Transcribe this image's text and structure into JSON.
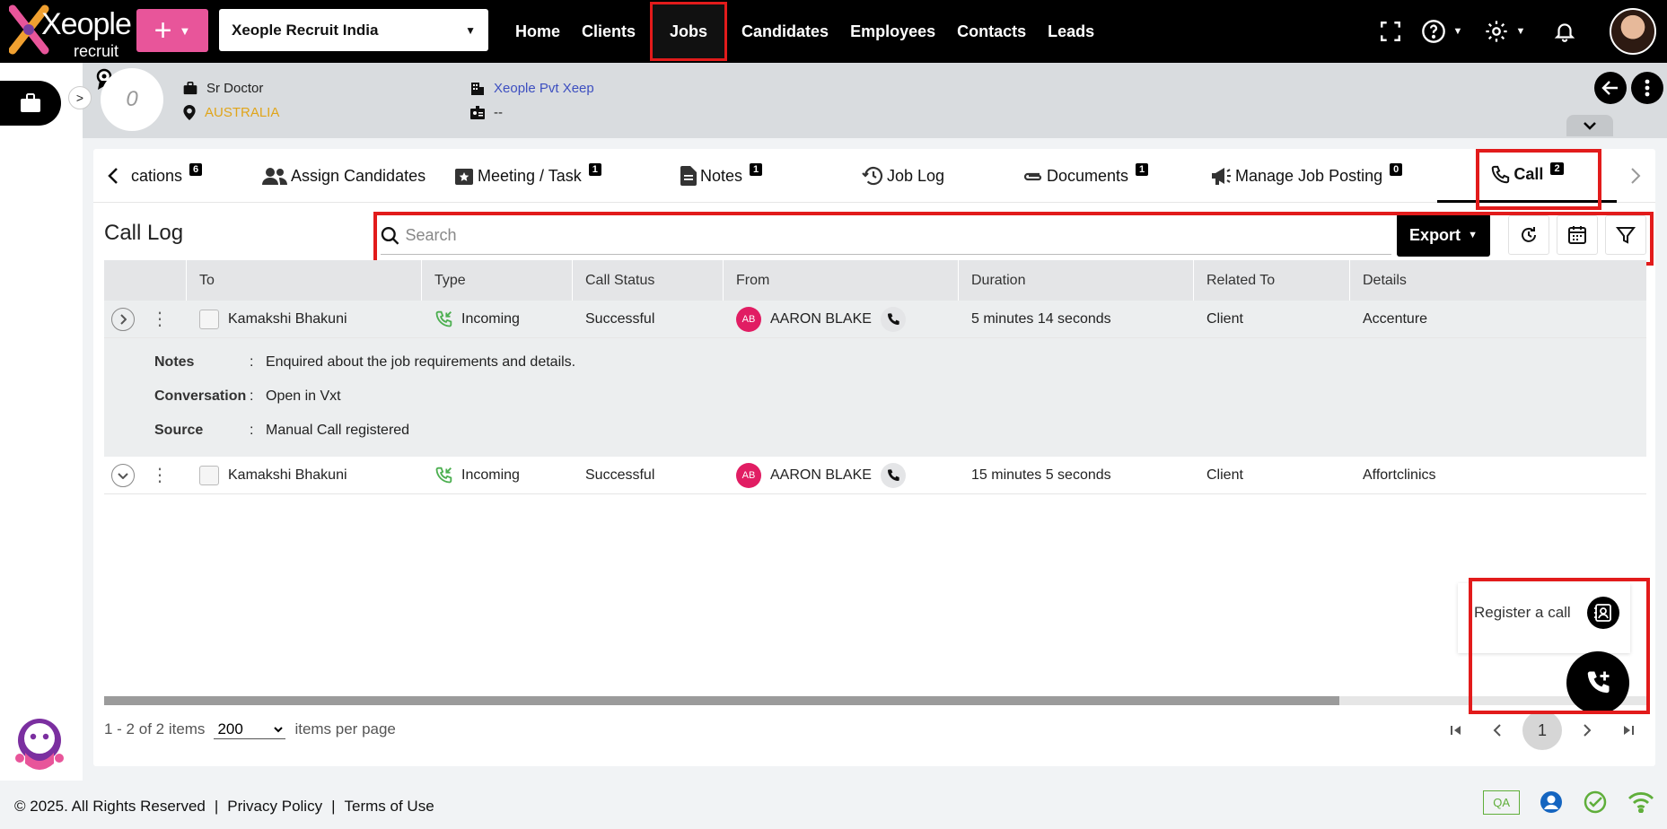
{
  "brand": {
    "name": "Xeople",
    "sub": "recruit"
  },
  "topbar": {
    "plus_label": "+",
    "company": "Xeople Recruit India",
    "nav": [
      {
        "label": "Home"
      },
      {
        "label": "Clients"
      },
      {
        "label": "Jobs",
        "active": true
      },
      {
        "label": "Candidates"
      },
      {
        "label": "Employees"
      },
      {
        "label": "Contacts"
      },
      {
        "label": "Leads"
      }
    ]
  },
  "job": {
    "circle_text": "0",
    "title": "Sr Doctor",
    "location": "AUSTRALIA",
    "company": "Xeople Pvt Xeep",
    "id_value": "--"
  },
  "tabs": [
    {
      "label": "cations",
      "count": "6"
    },
    {
      "label": "Assign Candidates"
    },
    {
      "label": "Meeting / Task",
      "count": "1"
    },
    {
      "label": "Notes",
      "count": "1"
    },
    {
      "label": "Job Log"
    },
    {
      "label": "Documents",
      "count": "1"
    },
    {
      "label": "Manage Job Posting",
      "count": "0"
    },
    {
      "label": "Call",
      "count": "2",
      "active": true
    }
  ],
  "call_log": {
    "title": "Call Log",
    "search_placeholder": "Search",
    "export_label": "Export",
    "columns": [
      "To",
      "Type",
      "Call Status",
      "From",
      "Duration",
      "Related To",
      "Details"
    ],
    "rows": [
      {
        "to": "Kamakshi Bhakuni",
        "type": "Incoming",
        "status": "Successful",
        "from_initials": "AB",
        "from": "AARON BLAKE",
        "duration": "5 minutes 14 seconds",
        "related_to": "Client",
        "details": "Accenture",
        "expanded": true,
        "notes_label": "Notes",
        "notes": "Enquired about the job requirements and details.",
        "conversation_label": "Conversation",
        "conversation": "Open in Vxt",
        "source_label": "Source",
        "source": "Manual Call registered"
      },
      {
        "to": "Kamakshi Bhakuni",
        "type": "Incoming",
        "status": "Successful",
        "from_initials": "AB",
        "from": "AARON BLAKE",
        "duration": "15 minutes 5 seconds",
        "related_to": "Client",
        "details": "Affortclinics",
        "expanded": false
      }
    ]
  },
  "pager": {
    "summary": "1 - 2 of 2 items",
    "page_size": "200",
    "per_page_label": "items per page",
    "current_page": "1"
  },
  "register_call": {
    "label": "Register a call"
  },
  "footer": {
    "copyright": "© 2025. All Rights Reserved",
    "privacy": "Privacy Policy",
    "terms": "Terms of Use",
    "qa": "QA"
  },
  "colors": {
    "accent_pink": "#e8559a",
    "highlight_red": "#e21b1b",
    "location_gold": "#e0a51a",
    "link_blue": "#3d4fc0",
    "badge_magenta": "#e11d63",
    "incoming_green": "#4caf50"
  }
}
